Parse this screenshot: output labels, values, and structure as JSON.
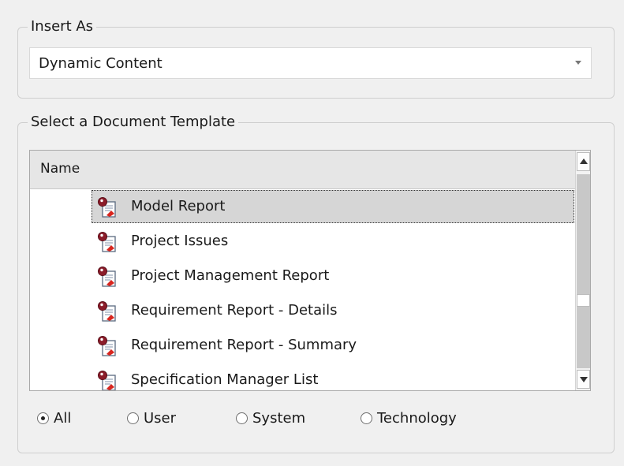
{
  "insert_as": {
    "legend": "Insert As",
    "selected": "Dynamic Content"
  },
  "template_group": {
    "legend": "Select a Document Template",
    "column_header": "Name",
    "items": [
      {
        "label": "Model Report",
        "selected": true
      },
      {
        "label": "Project Issues",
        "selected": false
      },
      {
        "label": "Project Management Report",
        "selected": false
      },
      {
        "label": "Requirement Report - Details",
        "selected": false
      },
      {
        "label": "Requirement Report - Summary",
        "selected": false
      },
      {
        "label": "Specification Manager List",
        "selected": false
      }
    ],
    "item_icon": "report-template-icon"
  },
  "filter": {
    "options": [
      {
        "label": "All",
        "checked": true
      },
      {
        "label": "User",
        "checked": false
      },
      {
        "label": "System",
        "checked": false
      },
      {
        "label": "Technology",
        "checked": false
      }
    ]
  }
}
